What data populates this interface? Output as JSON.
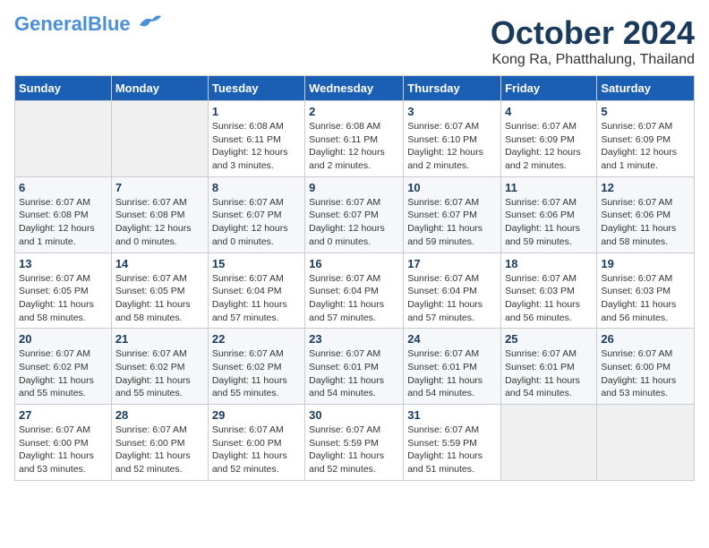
{
  "header": {
    "logo_general": "General",
    "logo_blue": "Blue",
    "title": "October 2024",
    "subtitle": "Kong Ra, Phatthalung, Thailand"
  },
  "calendar": {
    "days_of_week": [
      "Sunday",
      "Monday",
      "Tuesday",
      "Wednesday",
      "Thursday",
      "Friday",
      "Saturday"
    ],
    "weeks": [
      [
        {
          "day": "",
          "info": ""
        },
        {
          "day": "",
          "info": ""
        },
        {
          "day": "1",
          "info": "Sunrise: 6:08 AM\nSunset: 6:11 PM\nDaylight: 12 hours and 3 minutes."
        },
        {
          "day": "2",
          "info": "Sunrise: 6:08 AM\nSunset: 6:11 PM\nDaylight: 12 hours and 2 minutes."
        },
        {
          "day": "3",
          "info": "Sunrise: 6:07 AM\nSunset: 6:10 PM\nDaylight: 12 hours and 2 minutes."
        },
        {
          "day": "4",
          "info": "Sunrise: 6:07 AM\nSunset: 6:09 PM\nDaylight: 12 hours and 2 minutes."
        },
        {
          "day": "5",
          "info": "Sunrise: 6:07 AM\nSunset: 6:09 PM\nDaylight: 12 hours and 1 minute."
        }
      ],
      [
        {
          "day": "6",
          "info": "Sunrise: 6:07 AM\nSunset: 6:08 PM\nDaylight: 12 hours and 1 minute."
        },
        {
          "day": "7",
          "info": "Sunrise: 6:07 AM\nSunset: 6:08 PM\nDaylight: 12 hours and 0 minutes."
        },
        {
          "day": "8",
          "info": "Sunrise: 6:07 AM\nSunset: 6:07 PM\nDaylight: 12 hours and 0 minutes."
        },
        {
          "day": "9",
          "info": "Sunrise: 6:07 AM\nSunset: 6:07 PM\nDaylight: 12 hours and 0 minutes."
        },
        {
          "day": "10",
          "info": "Sunrise: 6:07 AM\nSunset: 6:07 PM\nDaylight: 11 hours and 59 minutes."
        },
        {
          "day": "11",
          "info": "Sunrise: 6:07 AM\nSunset: 6:06 PM\nDaylight: 11 hours and 59 minutes."
        },
        {
          "day": "12",
          "info": "Sunrise: 6:07 AM\nSunset: 6:06 PM\nDaylight: 11 hours and 58 minutes."
        }
      ],
      [
        {
          "day": "13",
          "info": "Sunrise: 6:07 AM\nSunset: 6:05 PM\nDaylight: 11 hours and 58 minutes."
        },
        {
          "day": "14",
          "info": "Sunrise: 6:07 AM\nSunset: 6:05 PM\nDaylight: 11 hours and 58 minutes."
        },
        {
          "day": "15",
          "info": "Sunrise: 6:07 AM\nSunset: 6:04 PM\nDaylight: 11 hours and 57 minutes."
        },
        {
          "day": "16",
          "info": "Sunrise: 6:07 AM\nSunset: 6:04 PM\nDaylight: 11 hours and 57 minutes."
        },
        {
          "day": "17",
          "info": "Sunrise: 6:07 AM\nSunset: 6:04 PM\nDaylight: 11 hours and 57 minutes."
        },
        {
          "day": "18",
          "info": "Sunrise: 6:07 AM\nSunset: 6:03 PM\nDaylight: 11 hours and 56 minutes."
        },
        {
          "day": "19",
          "info": "Sunrise: 6:07 AM\nSunset: 6:03 PM\nDaylight: 11 hours and 56 minutes."
        }
      ],
      [
        {
          "day": "20",
          "info": "Sunrise: 6:07 AM\nSunset: 6:02 PM\nDaylight: 11 hours and 55 minutes."
        },
        {
          "day": "21",
          "info": "Sunrise: 6:07 AM\nSunset: 6:02 PM\nDaylight: 11 hours and 55 minutes."
        },
        {
          "day": "22",
          "info": "Sunrise: 6:07 AM\nSunset: 6:02 PM\nDaylight: 11 hours and 55 minutes."
        },
        {
          "day": "23",
          "info": "Sunrise: 6:07 AM\nSunset: 6:01 PM\nDaylight: 11 hours and 54 minutes."
        },
        {
          "day": "24",
          "info": "Sunrise: 6:07 AM\nSunset: 6:01 PM\nDaylight: 11 hours and 54 minutes."
        },
        {
          "day": "25",
          "info": "Sunrise: 6:07 AM\nSunset: 6:01 PM\nDaylight: 11 hours and 54 minutes."
        },
        {
          "day": "26",
          "info": "Sunrise: 6:07 AM\nSunset: 6:00 PM\nDaylight: 11 hours and 53 minutes."
        }
      ],
      [
        {
          "day": "27",
          "info": "Sunrise: 6:07 AM\nSunset: 6:00 PM\nDaylight: 11 hours and 53 minutes."
        },
        {
          "day": "28",
          "info": "Sunrise: 6:07 AM\nSunset: 6:00 PM\nDaylight: 11 hours and 52 minutes."
        },
        {
          "day": "29",
          "info": "Sunrise: 6:07 AM\nSunset: 6:00 PM\nDaylight: 11 hours and 52 minutes."
        },
        {
          "day": "30",
          "info": "Sunrise: 6:07 AM\nSunset: 5:59 PM\nDaylight: 11 hours and 52 minutes."
        },
        {
          "day": "31",
          "info": "Sunrise: 6:07 AM\nSunset: 5:59 PM\nDaylight: 11 hours and 51 minutes."
        },
        {
          "day": "",
          "info": ""
        },
        {
          "day": "",
          "info": ""
        }
      ]
    ]
  }
}
